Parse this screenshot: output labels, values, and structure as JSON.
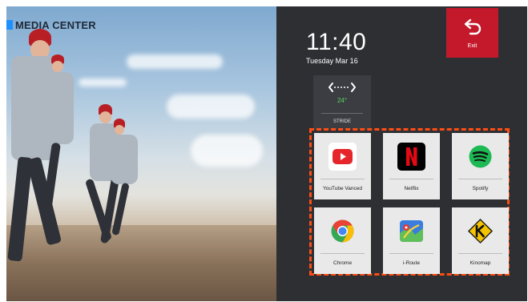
{
  "screen_title": "MEDIA CENTER",
  "clock": {
    "time": "11:40",
    "date": "Tuesday Mar 16"
  },
  "exit": {
    "label": "Exit",
    "icon": "exit-arrow-icon",
    "color": "#c4192a"
  },
  "stride_widget": {
    "label": "STRIDE",
    "temperature": "24°",
    "icon": "stride-arrows-icon"
  },
  "apps": [
    {
      "label": "YouTube Vanced",
      "icon": "youtube-icon"
    },
    {
      "label": "Netflix",
      "icon": "netflix-icon"
    },
    {
      "label": "Spotify",
      "icon": "spotify-icon"
    },
    {
      "label": "Chrome",
      "icon": "chrome-icon"
    },
    {
      "label": "i-Route",
      "icon": "map-route-icon"
    },
    {
      "label": "Kinomap",
      "icon": "kinomap-icon"
    }
  ],
  "colors": {
    "accent_blue": "#1e90ff",
    "highlight_outline": "#ff4d14",
    "panel_bg": "#2e2f33"
  }
}
